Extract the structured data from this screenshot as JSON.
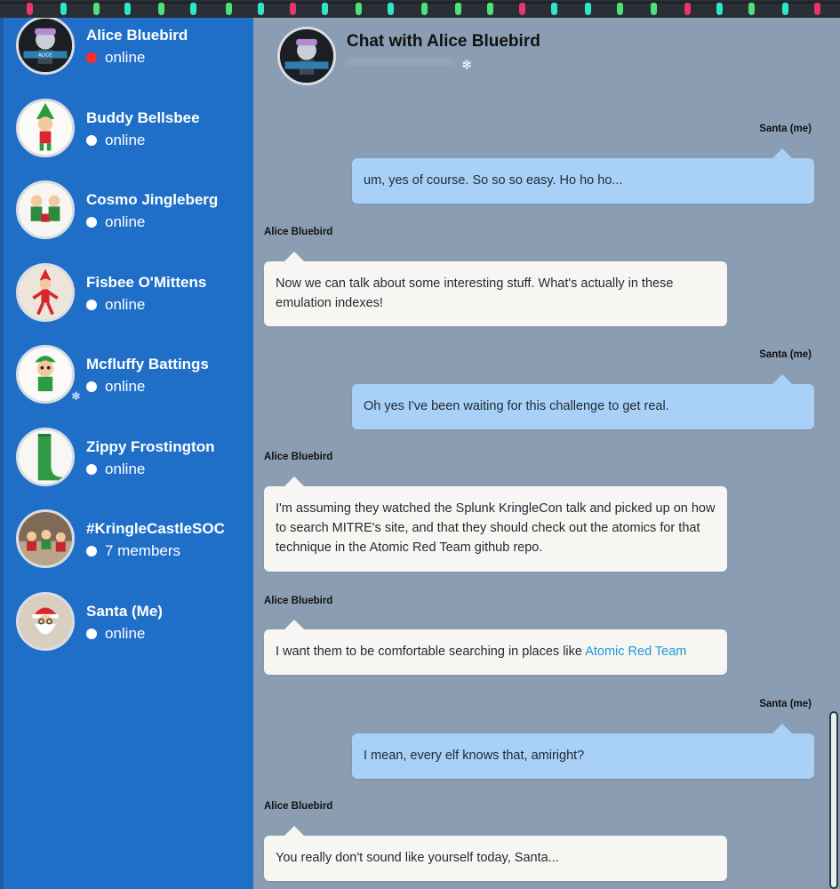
{
  "sidebar": {
    "contacts": [
      {
        "name": "Alice Bluebird",
        "status": "online",
        "status_color": "#ff2a2a"
      },
      {
        "name": "Buddy Bellsbee",
        "status": "online",
        "status_color": "#ffffff"
      },
      {
        "name": "Cosmo Jingleberg",
        "status": "online",
        "status_color": "#ffffff"
      },
      {
        "name": "Fisbee O'Mittens",
        "status": "online",
        "status_color": "#ffffff"
      },
      {
        "name": "Mcfluffy Battings",
        "status": "online",
        "status_color": "#ffffff"
      },
      {
        "name": "Zippy Frostington",
        "status": "online",
        "status_color": "#ffffff"
      },
      {
        "name": "#KringleCastleSOC",
        "status": "7 members",
        "status_color": "#ffffff"
      },
      {
        "name": "Santa (Me)",
        "status": "online",
        "status_color": "#ffffff"
      }
    ]
  },
  "chat": {
    "title": "Chat with Alice Bluebird",
    "messages": [
      {
        "sender": "Santa (me)",
        "text": "um, yes of course. So so so easy. Ho ho ho..."
      },
      {
        "sender": "Alice Bluebird",
        "text": "Now we can talk about some interesting stuff. What's actually in these emulation indexes!"
      },
      {
        "sender": "Santa (me)",
        "text": "Oh yes I've been waiting for this challenge to get real."
      },
      {
        "sender": "Alice Bluebird",
        "text": "I'm assuming they watched the Splunk KringleCon talk and picked up on how to search MITRE's site, and that they should check out the atomics for that technique in the Atomic Red Team github repo."
      },
      {
        "sender": "Alice Bluebird",
        "text": "I want them to be comfortable searching in places like ",
        "link": "Atomic Red Team"
      },
      {
        "sender": "Santa (me)",
        "text": "I mean, every elf knows that, amiright?"
      },
      {
        "sender": "Alice Bluebird",
        "text": "You really don't sound like yourself today, Santa..."
      }
    ]
  },
  "colors": {
    "sidebar_bg": "#1f6fc9",
    "chat_bg": "#8a9db3",
    "my_bubble": "#a9d0f7",
    "their_bubble": "#f8f6f2",
    "link": "#1a9ad6"
  }
}
